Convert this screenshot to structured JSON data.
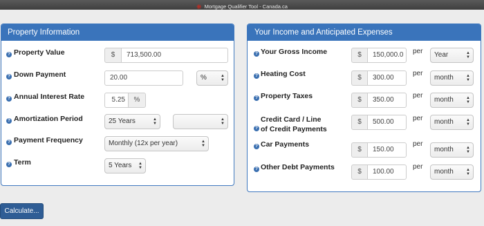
{
  "window": {
    "title": "Mortgage Qualifier Tool - Canada.ca"
  },
  "property_panel": {
    "title": "Property Information",
    "property_value": {
      "label": "Property Value",
      "prefix": "$",
      "value": "713,500.00"
    },
    "down_payment": {
      "label": "Down Payment",
      "value": "20.00",
      "unit_select": "%"
    },
    "interest_rate": {
      "label": "Annual Interest Rate",
      "value": "5.25",
      "suffix": "%"
    },
    "amortization": {
      "label": "Amortization Period",
      "years_select": "25 Years",
      "months_select": ""
    },
    "payment_frequency": {
      "label": "Payment Frequency",
      "select": "Monthly (12x per year)"
    },
    "term": {
      "label": "Term",
      "select": "5 Years"
    }
  },
  "income_panel": {
    "title": "Your Income and Anticipated Expenses",
    "per_label": "per",
    "rows": [
      {
        "label": "Your Gross Income",
        "prefix": "$",
        "value": "150,000.0",
        "period": "Year"
      },
      {
        "label": "Heating Cost",
        "prefix": "$",
        "value": "300.00",
        "period": "month"
      },
      {
        "label": "Property Taxes",
        "prefix": "$",
        "value": "350.00",
        "period": "month"
      },
      {
        "label_line1": "Credit Card / Line",
        "label_line2": "of Credit Payments",
        "prefix": "$",
        "value": "500.00",
        "period": "month"
      },
      {
        "label": "Car Payments",
        "prefix": "$",
        "value": "150.00",
        "period": "month"
      },
      {
        "label": "Other Debt Payments",
        "prefix": "$",
        "value": "100.00",
        "period": "month"
      }
    ]
  },
  "actions": {
    "calculate_label": "Calculate..."
  },
  "icons": {
    "help": "help-circle-icon",
    "select_arrow": "updown-arrow-icon",
    "brand": "maple-leaf-icon"
  }
}
